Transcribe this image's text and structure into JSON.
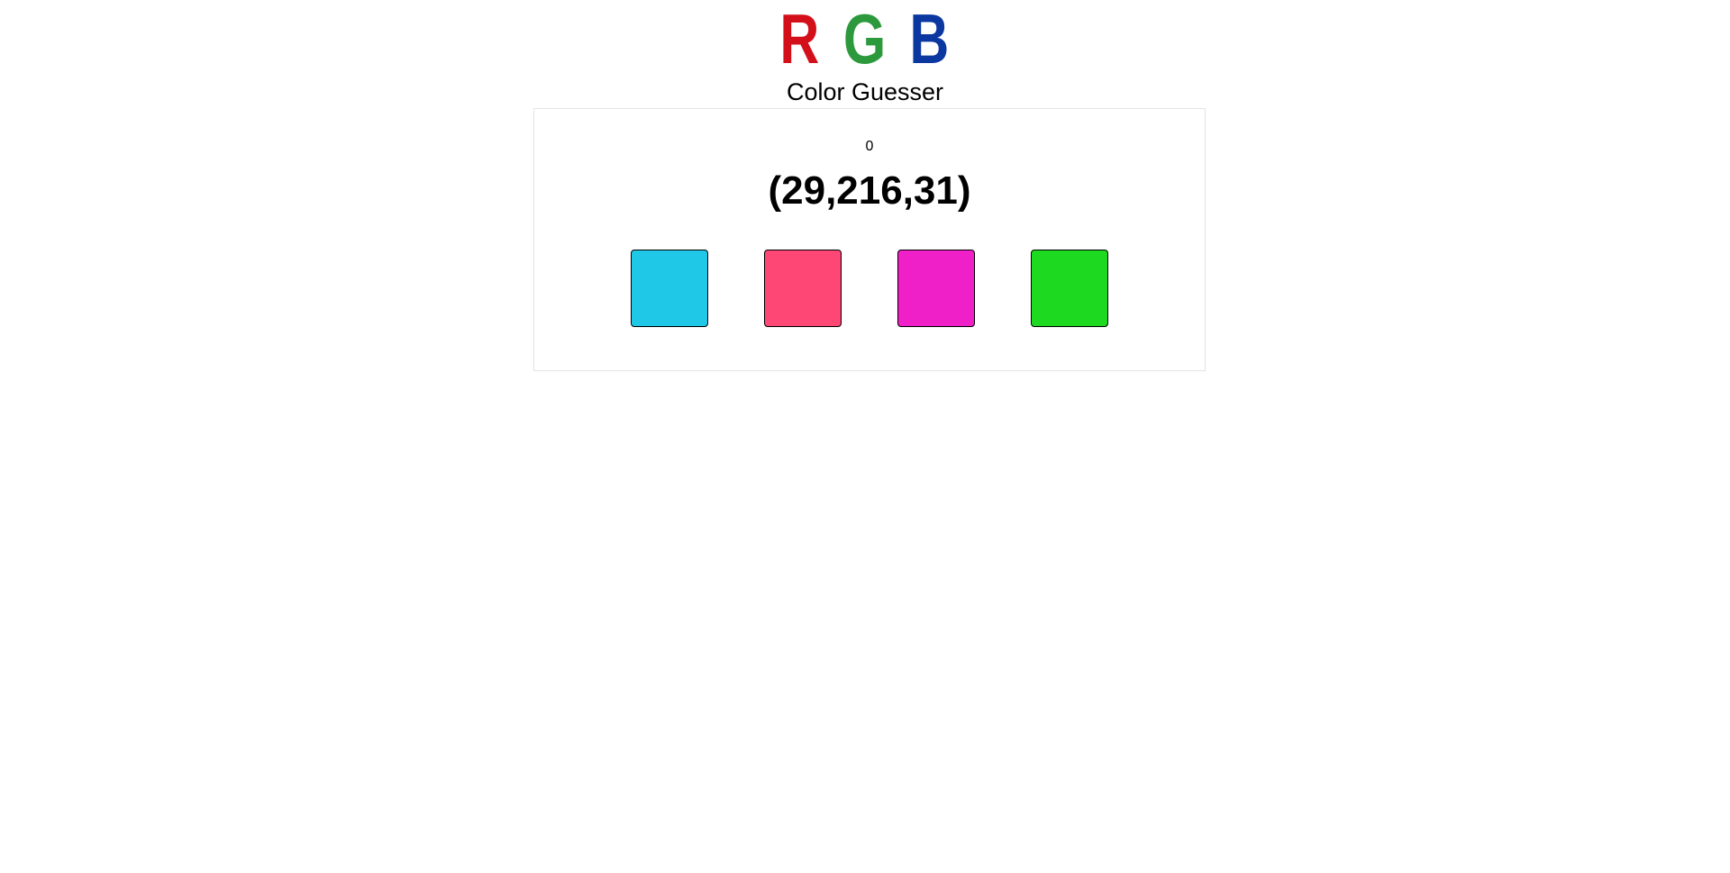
{
  "logo": {
    "letters": [
      {
        "char": "R",
        "color": "#d30f1a"
      },
      {
        "char": "G",
        "color": "#2c9a3c"
      },
      {
        "char": "B",
        "color": "#0a37a0"
      }
    ]
  },
  "subtitle": "Color Guesser",
  "game": {
    "score": "0",
    "target_rgb": "(29,216,31)",
    "options": [
      {
        "name": "option-1",
        "color": "#1fc8e6"
      },
      {
        "name": "option-2",
        "color": "#ff4775"
      },
      {
        "name": "option-3",
        "color": "#ef20c8"
      },
      {
        "name": "option-4",
        "color": "#1dd91f"
      }
    ]
  }
}
